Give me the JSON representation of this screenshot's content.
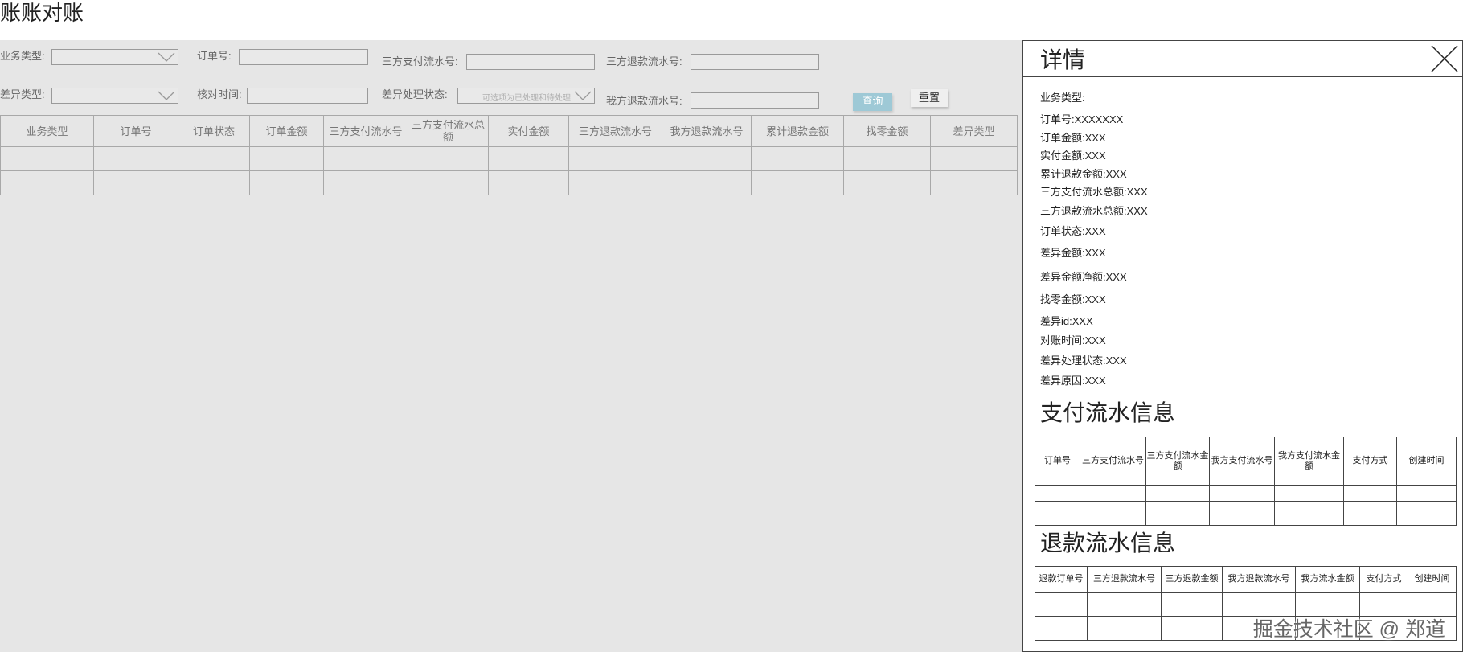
{
  "page": {
    "title": "账账对账"
  },
  "filters": {
    "row1": [
      {
        "label": "业务类型:",
        "type": "select",
        "placeholder": ""
      },
      {
        "label": "订单号:",
        "type": "input"
      },
      {
        "label": "三方支付流水号:",
        "type": "input"
      },
      {
        "label": "三方退款流水号:",
        "type": "input"
      }
    ],
    "row2": [
      {
        "label": "差异类型:",
        "type": "select",
        "placeholder": ""
      },
      {
        "label": "核对时间:",
        "type": "input"
      },
      {
        "label": "差异处理状态:",
        "type": "select",
        "placeholder": "可选项为已处理和待处理"
      },
      {
        "label": "我方退款流水号:",
        "type": "input"
      }
    ],
    "query_label": "查询",
    "reset_label": "重置"
  },
  "main_table": {
    "columns": [
      "业务类型",
      "订单号",
      "订单状态",
      "订单金额",
      "三方支付流水号",
      "三方支付流水总额",
      "实付金额",
      "三方退款流水号",
      "我方退款流水号",
      "累计退款金额",
      "找零金额",
      "差异类型"
    ],
    "row_count": 2
  },
  "detail": {
    "title": "详情",
    "fields": [
      "业务类型:",
      "订单号:XXXXXXX",
      "订单金额:XXX",
      "实付金额:XXX",
      "累计退款金额:XXX",
      "三方支付流水总额:XXX",
      "三方退款流水总额:XXX",
      "订单状态:XXX",
      "差异金额:XXX",
      "差异金额净额:XXX",
      "找零金额:XXX",
      "差异id:XXX",
      "对账时间:XXX",
      "差异处理状态:XXX",
      "差异原因:XXX"
    ],
    "payment_section": {
      "title": "支付流水信息",
      "columns": [
        "订单号",
        "三方支付流水号",
        "三方支付流水金额",
        "我方支付流水号",
        "我方支付流水金额",
        "支付方式",
        "创建时间"
      ],
      "row_count": 2
    },
    "refund_section": {
      "title": "退款流水信息",
      "columns": [
        "退款订单号",
        "三方退款流水号",
        "三方退款金额",
        "我方退款流水号",
        "我方流水金额",
        "支付方式",
        "创建时间"
      ],
      "row_count": 2
    }
  },
  "watermark": "掘金技术社区 @ 郑道"
}
